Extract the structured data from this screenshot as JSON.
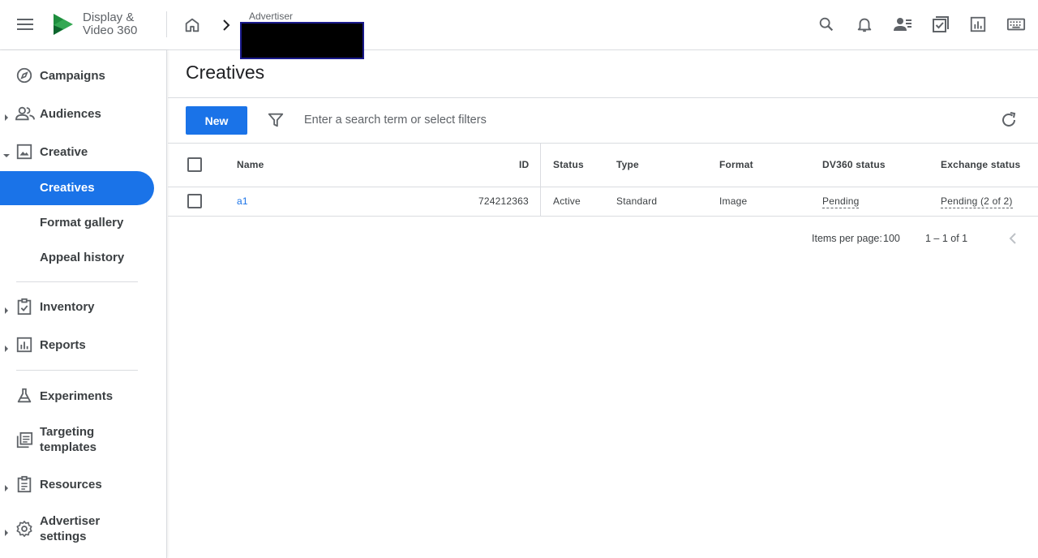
{
  "header": {
    "product_name": "Display & Video 360",
    "advertiser_label": "Advertiser"
  },
  "sidebar": {
    "items": [
      {
        "label": "Campaigns",
        "icon": "compass-icon"
      },
      {
        "label": "Audiences",
        "icon": "people-icon"
      },
      {
        "label": "Creative",
        "icon": "image-icon"
      },
      {
        "label": "Creatives"
      },
      {
        "label": "Format gallery"
      },
      {
        "label": "Appeal history"
      },
      {
        "label": "Inventory",
        "icon": "clipboard-check-icon"
      },
      {
        "label": "Reports",
        "icon": "bar-chart-icon"
      },
      {
        "label": "Experiments",
        "icon": "flask-icon"
      },
      {
        "label": "Targeting templates",
        "icon": "library-icon"
      },
      {
        "label": "Resources",
        "icon": "document-list-icon"
      },
      {
        "label": "Advertiser settings",
        "icon": "gear-icon"
      }
    ]
  },
  "main": {
    "title": "Creatives",
    "new_label": "New",
    "search_placeholder": "Enter a search term or select filters",
    "table": {
      "headers": [
        "Name",
        "ID",
        "Status",
        "Type",
        "Format",
        "DV360 status",
        "Exchange status"
      ],
      "rows": [
        {
          "name": "a1",
          "id": "724212363",
          "status": "Active",
          "type": "Standard",
          "format": "Image",
          "dv360_status": "Pending",
          "exchange_status": "Pending (2 of 2)"
        }
      ]
    },
    "pagination": {
      "items_per_page_label": "Items per page:",
      "items_per_page": "100",
      "range": "1 – 1 of 1"
    }
  },
  "colors": {
    "accent": "#1a73e8",
    "text": "#202124",
    "divider": "#dadce0"
  }
}
